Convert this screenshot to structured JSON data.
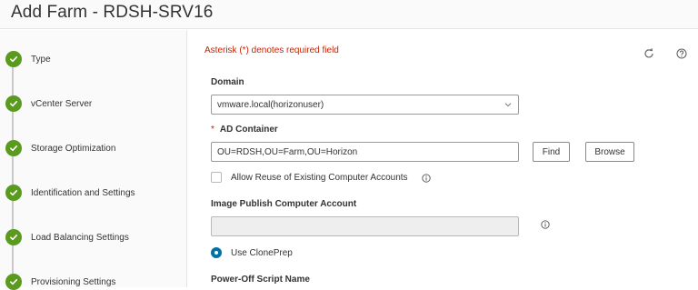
{
  "header": {
    "title": "Add Farm - RDSH-SRV16"
  },
  "steps": [
    {
      "label": "Type"
    },
    {
      "label": "vCenter Server"
    },
    {
      "label": "Storage Optimization"
    },
    {
      "label": "Identification and Settings"
    },
    {
      "label": "Load Balancing Settings"
    },
    {
      "label": "Provisioning Settings"
    }
  ],
  "form": {
    "required_note": "Asterisk (*) denotes required field",
    "domain": {
      "label": "Domain",
      "value": "vmware.local(horizonuser)"
    },
    "ad_container": {
      "required_mark": "*",
      "label": "AD Container",
      "value": "OU=RDSH,OU=Farm,OU=Horizon",
      "find_label": "Find",
      "browse_label": "Browse"
    },
    "allow_reuse": {
      "label": "Allow Reuse of Existing Computer Accounts",
      "checked": false
    },
    "image_publish": {
      "label": "Image Publish Computer Account",
      "value": ""
    },
    "use_cloneprep": {
      "label": "Use ClonePrep",
      "selected": true
    },
    "power_off_script": {
      "label": "Power-Off Script Name"
    }
  },
  "colors": {
    "accent": "#0072a3",
    "success": "#5a9a1f",
    "required": "#c92100"
  }
}
